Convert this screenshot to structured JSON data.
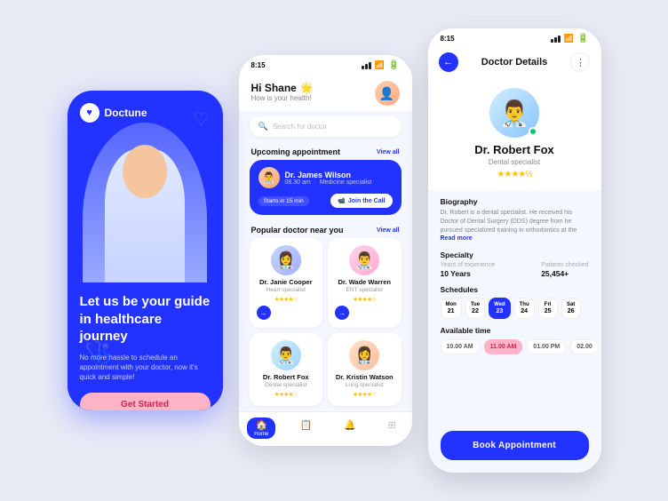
{
  "app": {
    "brand": "Doctune"
  },
  "screen1": {
    "brand": "Doctune",
    "title": "Let us be your guide in healthcare journey",
    "subtitle": "No more hassle to schedule an appointment with your doctor, now it's quick and simple!",
    "cta": "Get Started"
  },
  "screen2": {
    "status_time": "8:15",
    "greeting": "Hi Shane",
    "greeting_emoji": "🌟",
    "greeting_sub": "How is your health!",
    "search_placeholder": "Search for doctor",
    "upcoming_label": "Upcoming appointment",
    "view_all": "View all",
    "appointment": {
      "doctor_name": "Dr. James Wilson",
      "time": "08.30 am",
      "specialty": "Medicine specialist",
      "starts_label": "Starts in 15 min",
      "join_label": "Join the Call"
    },
    "popular_label": "Popular doctor near you",
    "doctors": [
      {
        "name": "Dr. Janie Cooper",
        "specialty": "Heart specialist",
        "stars": "★★★★☆",
        "avatar_color": "blue"
      },
      {
        "name": "Dr. Wade Warren",
        "specialty": "ENT specialist",
        "stars": "★★★★☆",
        "avatar_color": "pink"
      },
      {
        "name": "Dr. Robert Fox",
        "specialty": "Dental specialist",
        "stars": "★★★★☆",
        "avatar_color": "lightblue"
      },
      {
        "name": "Dr. Kristin Watson",
        "specialty": "Lung specialist",
        "stars": "★★★★☆",
        "avatar_color": "peach"
      }
    ],
    "nav": [
      {
        "label": "Home",
        "icon": "🏠",
        "active": true
      },
      {
        "label": "Calendar",
        "icon": "📋",
        "active": false
      },
      {
        "label": "Bell",
        "icon": "🔔",
        "active": false
      },
      {
        "label": "Grid",
        "icon": "⊞",
        "active": false
      }
    ]
  },
  "screen3": {
    "status_time": "8:15",
    "title": "Doctor Details",
    "doctor_name": "Dr. Robert Fox",
    "doctor_specialty": "Dental specialist",
    "stars": "★★★★½",
    "bio_label": "Biography",
    "bio_text": "Dr. Robert is a dental specialist. He received his Doctor of Dental Surgery (DDS) degree from he pursued specialized training in orthodontics at the",
    "read_more": "Read more",
    "specialty_label": "Specialty",
    "years_label": "Years of experience",
    "years_value": "10 Years",
    "patients_label": "Patients checked",
    "patients_value": "25,454+",
    "schedules_label": "Schedules",
    "days": [
      {
        "name": "Mon",
        "num": "21",
        "active": false
      },
      {
        "name": "Tue",
        "num": "22",
        "active": false
      },
      {
        "name": "Wed",
        "num": "23",
        "active": true
      },
      {
        "name": "Thu",
        "num": "24",
        "active": false
      },
      {
        "name": "Fri",
        "num": "25",
        "active": false
      },
      {
        "name": "Sat",
        "num": "26",
        "active": false
      }
    ],
    "available_label": "Available time",
    "time_slots": [
      {
        "time": "10.00 AM",
        "active": false
      },
      {
        "time": "11.00 AM",
        "active": true
      },
      {
        "time": "01.00 PM",
        "active": false
      },
      {
        "time": "02.00",
        "active": false
      }
    ],
    "book_label": "Book Appointment"
  }
}
